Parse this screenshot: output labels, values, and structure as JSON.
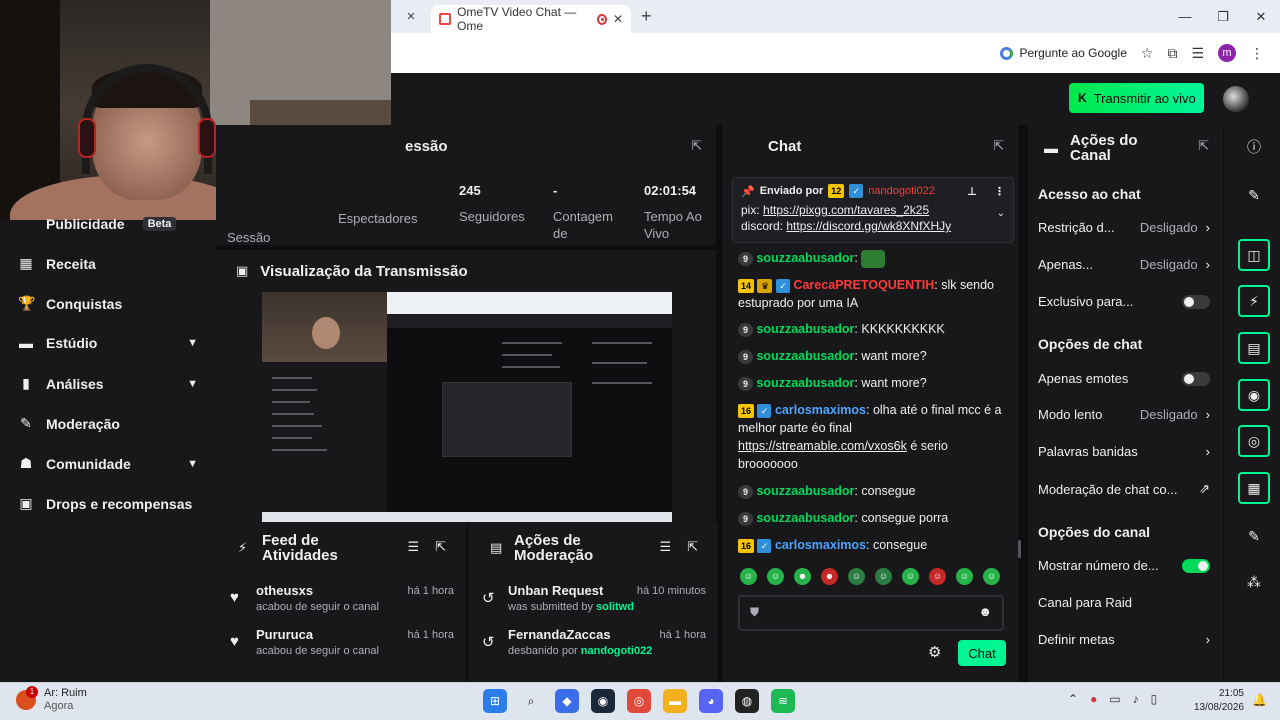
{
  "browser": {
    "tab_title": "OmeTV Video Chat — Ome",
    "ask_google": "Pergunte ao Google",
    "profile_initial": "m"
  },
  "topbar": {
    "live_button": "Transmitir ao vivo"
  },
  "nav": {
    "publicidade": "Publicidade",
    "beta": "Beta",
    "receita": "Receita",
    "conquistas": "Conquistas",
    "estudio": "Estúdio",
    "analises": "Análises",
    "moderacao": "Moderação",
    "comunidade": "Comunidade",
    "drops": "Drops e recompensas"
  },
  "stats": {
    "title": "essão",
    "sessao": "Sessão",
    "espectadores": "Espectadores",
    "seguidores_value": "245",
    "seguidores": "Seguidores",
    "contagem_value": "-",
    "contagem_l1": "Contagem",
    "contagem_l2": "de",
    "tempo_value": "02:01:54",
    "tempo_l1": "Tempo Ao",
    "tempo_l2": "Vivo"
  },
  "preview": {
    "title": "Visualização da Transmissão"
  },
  "feed": {
    "title_l1": "Feed de",
    "title_l2": "Atividades",
    "items": [
      {
        "name": "otheusxs",
        "sub": "acabou de seguir o canal",
        "time": "há 1 hora"
      },
      {
        "name": "Pururuca",
        "sub": "acabou de seguir o canal",
        "time": "há 1 hora"
      }
    ]
  },
  "moderation": {
    "title_l1": "Ações de",
    "title_l2": "Moderação",
    "items": [
      {
        "name": "Unban Request",
        "sub_prefix": "was submitted by",
        "user": "solitwd",
        "time": "há 10 minutos"
      },
      {
        "name": "FernandaZaccas",
        "sub_prefix": "desbanido por",
        "user": "nandogoti022",
        "time": "há 1 hora"
      }
    ]
  },
  "chat": {
    "title": "Chat",
    "pinned": {
      "sent_by": "Enviado por",
      "badge": "12",
      "user": "nandogoti022",
      "line1_prefix": "pix:",
      "line1_link": "https://pixgg.com/tavares_2k25",
      "line2_prefix": "discord:",
      "line2_link": "https://discord.gg/wk8XNfXHJy"
    },
    "messages": [
      {
        "badge": "9",
        "user": "souzzaabusador",
        "text": ""
      },
      {
        "badge": "14",
        "user": "CarecaPRETOQUENTIH",
        "text": "slk sendo estuprado por uma IA"
      },
      {
        "badge": "9",
        "user": "souzzaabusador",
        "text": "KKKKKKKKKK"
      },
      {
        "badge": "9",
        "user": "souzzaabusador",
        "text": "want more?"
      },
      {
        "badge": "9",
        "user": "souzzaabusador",
        "text": "want more?"
      },
      {
        "badge": "16",
        "user": "carlosmaximos",
        "text": "olha até o final mcc é a melhor parte éo final",
        "link": "https://streamable.com/vxos6k",
        "text_after": "é serio brooooooo"
      },
      {
        "badge": "9",
        "user": "souzzaabusador",
        "text": "consegue"
      },
      {
        "badge": "9",
        "user": "souzzaabusador",
        "text": "consegue porra"
      },
      {
        "badge": "16",
        "user": "carlosmaximos",
        "text": "consegue"
      }
    ],
    "input_value": "",
    "send_button": "Chat"
  },
  "actions": {
    "title_l1": "Ações do",
    "title_l2": "Canal",
    "section_access": "Acesso ao chat",
    "restricao": "Restrição d...",
    "restricao_val": "Desligado",
    "apenas": "Apenas...",
    "apenas_val": "Desligado",
    "exclusivo": "Exclusivo para...",
    "section_chat_opts": "Opções de chat",
    "apenas_emotes": "Apenas emotes",
    "modo_lento": "Modo lento",
    "modo_lento_val": "Desligado",
    "palavras": "Palavras banidas",
    "moderacao_chat": "Moderação de chat co...",
    "section_channel": "Opções do canal",
    "mostrar": "Mostrar número de...",
    "raid": "Canal para Raid",
    "metas": "Definir metas"
  },
  "taskbar": {
    "weather_title": "Ar: Ruim",
    "weather_sub": "Agora",
    "weather_badge": "1",
    "time": "21:05",
    "date": "13/08/2026"
  }
}
